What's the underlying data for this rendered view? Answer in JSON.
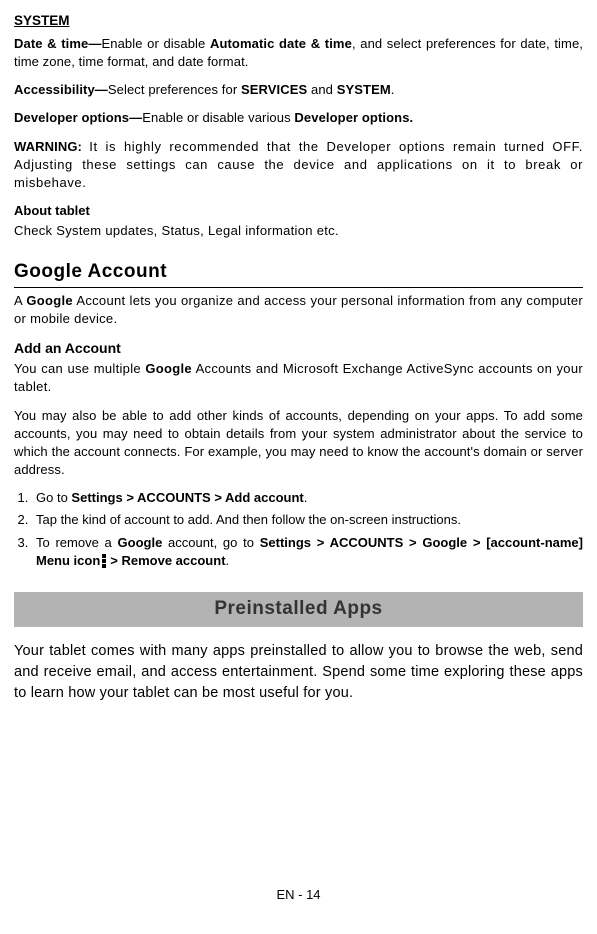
{
  "system": {
    "heading": "SYSTEM",
    "dateTime": {
      "label": "Date & time—",
      "pre": "Enable or disable ",
      "bold1": "Automatic date & time",
      "post": ", and select preferences for date, time, time zone, time format, and date format."
    },
    "accessibility": {
      "label": "Accessibility—",
      "pre": "Select preferences for ",
      "bold1": "SERVICES",
      "mid": " and ",
      "bold2": "SYSTEM",
      "post": "."
    },
    "developer": {
      "label": "Developer options—",
      "pre": "Enable or disable various ",
      "bold1": "Developer options."
    },
    "warning": {
      "label": "WARNING:  ",
      "text": "It is highly recommended that the Developer options remain turned OFF. Adjusting these settings can cause the device and applications on it to break or misbehave."
    },
    "aboutTablet": {
      "heading": "About tablet",
      "text": "Check System updates, Status, Legal information etc."
    }
  },
  "googleAccount": {
    "heading": "Google Account",
    "intro": {
      "pre": "A ",
      "bold1": "Google",
      "post": " Account lets you organize and access your personal information from any computer or mobile device."
    },
    "addAccount": {
      "heading": "Add an Account",
      "para1": {
        "pre": "You can use multiple ",
        "bold1": "Google",
        "post": " Accounts and Microsoft Exchange ActiveSync accounts on your tablet."
      },
      "para2": "You may also be able to add other kinds of accounts, depending on your apps. To add some accounts, you may need to obtain details from your system administrator about the service to which the account connects. For example, you may need to know the account's domain or server address."
    },
    "steps": {
      "step1": {
        "pre": "Go to ",
        "bold": "Settings > ACCOUNTS > Add account",
        "post": "."
      },
      "step2": "Tap the kind of account to add. And then follow the on-screen instructions.",
      "step3": {
        "pre": "To remove a ",
        "bold1": "Google",
        "mid1": " account, go to ",
        "bold2": "Settings > ACCOUNTS > Google > [account-name]  Menu icon",
        "bold3": "> Remove account",
        "post": "."
      }
    }
  },
  "preinstalled": {
    "heading": "Preinstalled Apps",
    "text": "Your tablet comes with many apps preinstalled to allow you to browse the web, send and receive email, and access entertainment. Spend some time exploring these apps to learn how your tablet can be most useful for you."
  },
  "footer": "EN - 14"
}
